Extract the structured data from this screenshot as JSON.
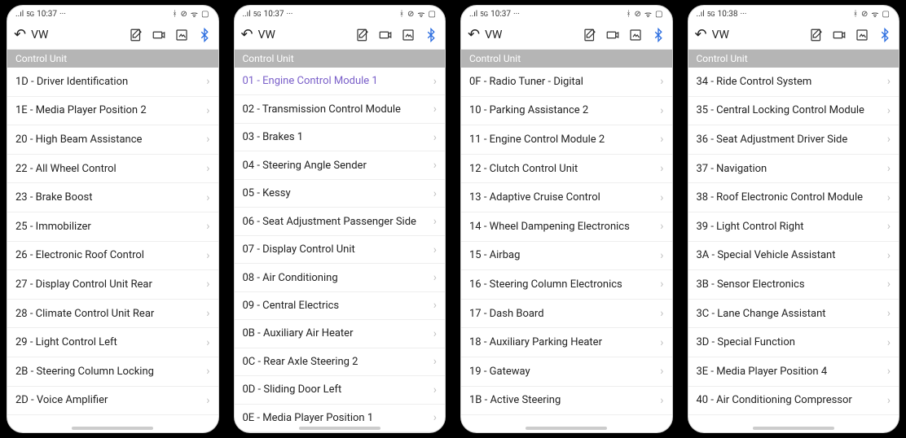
{
  "status": {
    "right_icons": "✱ ⦰ ᯤ ▯▯▯"
  },
  "app": {
    "title": "VW",
    "section_header": "Control Unit"
  },
  "phones": [
    {
      "time": "10:37",
      "items": [
        {
          "label": "1D - Driver Identification"
        },
        {
          "label": "1E - Media Player Position 2"
        },
        {
          "label": "20 - High Beam Assistance"
        },
        {
          "label": "22 - All Wheel Control"
        },
        {
          "label": "23 - Brake Boost"
        },
        {
          "label": "25 - Immobilizer"
        },
        {
          "label": "26 - Electronic Roof Control"
        },
        {
          "label": "27 - Display Control Unit Rear"
        },
        {
          "label": "28 - Climate Control Unit Rear"
        },
        {
          "label": "29 - Light Control Left"
        },
        {
          "label": "2B - Steering Column Locking"
        },
        {
          "label": "2D - Voice Amplifier"
        }
      ]
    },
    {
      "time": "10:37",
      "items": [
        {
          "label": "01 - Engine Control Module 1",
          "highlight": true
        },
        {
          "label": "02 - Transmission Control Module"
        },
        {
          "label": "03 - Brakes 1"
        },
        {
          "label": "04 - Steering Angle Sender"
        },
        {
          "label": "05 - Kessy"
        },
        {
          "label": "06 - Seat Adjustment Passenger Side"
        },
        {
          "label": "07 - Display Control Unit"
        },
        {
          "label": "08 - Air Conditioning"
        },
        {
          "label": "09 - Central Electrics"
        },
        {
          "label": "0B - Auxiliary Air Heater"
        },
        {
          "label": "0C - Rear Axle Steering 2"
        },
        {
          "label": "0D - Sliding Door Left"
        },
        {
          "label": "0E - Media Player Position 1"
        }
      ]
    },
    {
      "time": "10:37",
      "items": [
        {
          "label": "0F - Radio Tuner - Digital"
        },
        {
          "label": "10 - Parking Assistance 2"
        },
        {
          "label": "11 - Engine Control Module 2"
        },
        {
          "label": "12 - Clutch Control Unit"
        },
        {
          "label": "13 - Adaptive Cruise Control"
        },
        {
          "label": "14 - Wheel Dampening Electronics"
        },
        {
          "label": "15 - Airbag"
        },
        {
          "label": "16 - Steering Column Electronics"
        },
        {
          "label": "17 - Dash Board"
        },
        {
          "label": "18 - Auxiliary Parking Heater"
        },
        {
          "label": "19 - Gateway"
        },
        {
          "label": "1B - Active Steering"
        }
      ]
    },
    {
      "time": "10:38",
      "items": [
        {
          "label": "34 - Ride Control System"
        },
        {
          "label": "35 - Central Locking Control Module"
        },
        {
          "label": "36 - Seat Adjustment Driver Side"
        },
        {
          "label": "37 - Navigation"
        },
        {
          "label": "38 - Roof Electronic Control Module"
        },
        {
          "label": "39 - Light Control Right"
        },
        {
          "label": "3A - Special Vehicle Assistant"
        },
        {
          "label": "3B - Sensor Electronics"
        },
        {
          "label": "3C - Lane Change Assistant"
        },
        {
          "label": "3D - Special Function"
        },
        {
          "label": "3E - Media Player Position 4"
        },
        {
          "label": "40 - Air Conditioning Compressor"
        }
      ]
    }
  ]
}
